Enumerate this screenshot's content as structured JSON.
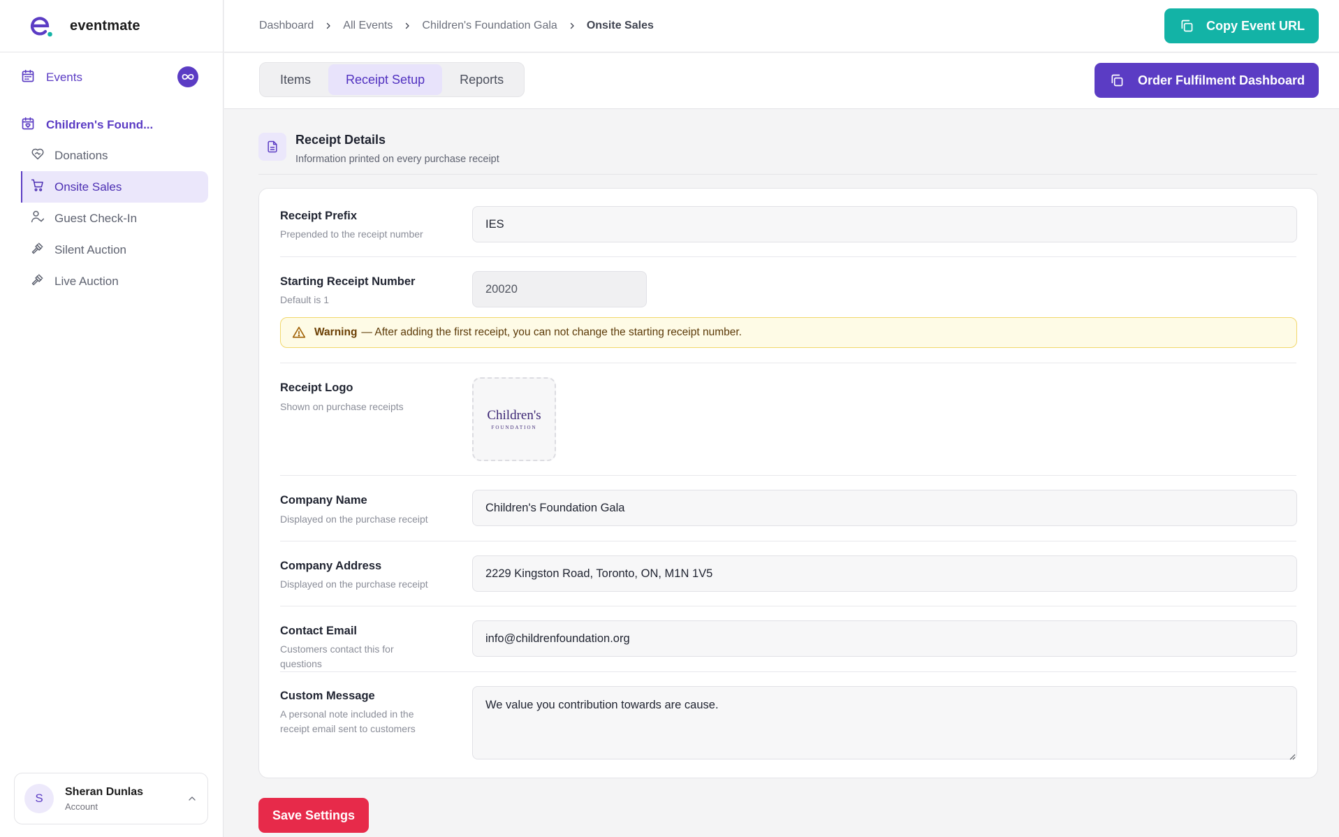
{
  "brand": {
    "name": "eventmate"
  },
  "sidebar": {
    "events_label": "Events",
    "events_badge_icon": "infinity-icon",
    "event_name": "Children's Found...",
    "items": [
      {
        "label": "Donations",
        "icon": "heart-handshake-icon",
        "active": false
      },
      {
        "label": "Onsite Sales",
        "icon": "cart-icon",
        "active": true
      },
      {
        "label": "Guest Check-In",
        "icon": "user-check-icon",
        "active": false
      },
      {
        "label": "Silent Auction",
        "icon": "gavel-icon",
        "active": false
      },
      {
        "label": "Live Auction",
        "icon": "gavel-icon",
        "active": false
      }
    ],
    "user": {
      "initial": "S",
      "name": "Sheran Dunlas",
      "subtitle": "Account"
    }
  },
  "header": {
    "breadcrumb": [
      "Dashboard",
      "All Events",
      "Children's Foundation Gala",
      "Onsite Sales"
    ],
    "copy_url_label": "Copy Event URL"
  },
  "subheader": {
    "tabs": [
      {
        "label": "Items",
        "active": false
      },
      {
        "label": "Receipt Setup",
        "active": true
      },
      {
        "label": "Reports",
        "active": false
      }
    ],
    "order_button_label": "Order Fulfilment Dashboard"
  },
  "section": {
    "title": "Receipt Details",
    "subtitle": "Information printed on every purchase receipt"
  },
  "form": {
    "receipt_prefix": {
      "label": "Receipt Prefix",
      "help": "Prepended to the receipt number",
      "value": "IES"
    },
    "starting_number": {
      "label": "Starting Receipt Number",
      "help": "Default is 1",
      "value": "20020"
    },
    "warning": {
      "title": "Warning",
      "text": "— After adding the first receipt, you can not change the starting receipt number."
    },
    "receipt_logo": {
      "label": "Receipt Logo",
      "help": "Shown on purchase receipts",
      "logo_text": "Children's",
      "logo_subtext": "FOUNDATION"
    },
    "company_name": {
      "label": "Company Name",
      "help": "Displayed on the purchase receipt",
      "value": "Children's Foundation Gala"
    },
    "company_address": {
      "label": "Company Address",
      "help": "Displayed on the purchase receipt",
      "value": "2229 Kingston Road, Toronto, ON, M1N 1V5"
    },
    "contact_email": {
      "label": "Contact Email",
      "help": "Customers contact this for questions",
      "value": "info@childrenfoundation.org"
    },
    "custom_message": {
      "label": "Custom Message",
      "help": "A personal note included in the receipt email sent to customers",
      "value": "We value you contribution towards are cause."
    }
  },
  "save_label": "Save Settings",
  "colors": {
    "primary": "#5b3cc4",
    "teal": "#13b3a6",
    "danger": "#e72a4a",
    "warning_bg": "#fefbe6",
    "warning_border": "#f1d76b"
  }
}
